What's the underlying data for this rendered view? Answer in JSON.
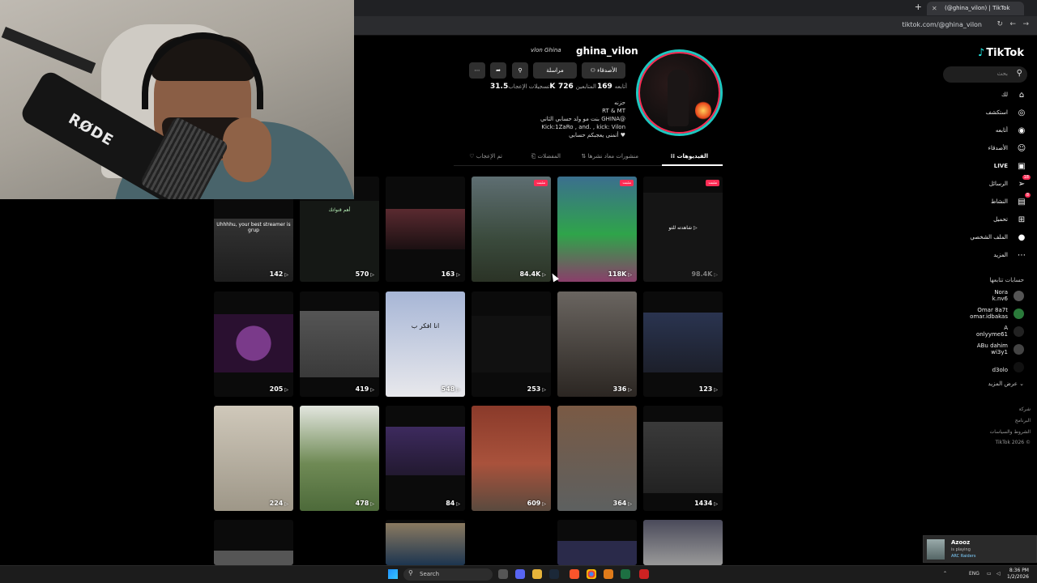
{
  "browser": {
    "tab_title": "(@ghina_vilon) | TikTok",
    "url": "tiktok.com/@ghina_vilon"
  },
  "sidebar": {
    "logo": "TikTok",
    "search_placeholder": "بحث",
    "items": [
      {
        "label": "لك",
        "icon": "home-icon"
      },
      {
        "label": "استكشف",
        "icon": "compass-icon"
      },
      {
        "label": "أتابعه",
        "icon": "following-icon"
      },
      {
        "label": "الأصدقاء",
        "icon": "friends-icon"
      },
      {
        "label": "LIVE",
        "icon": "live-icon"
      },
      {
        "label": "الرسائل",
        "icon": "messages-icon",
        "badge": "18"
      },
      {
        "label": "النشاط",
        "icon": "activity-icon",
        "badge": "8"
      },
      {
        "label": "تحميل",
        "icon": "upload-icon"
      },
      {
        "label": "الملف الشخصي",
        "icon": "profile-icon"
      },
      {
        "label": "المزيد",
        "icon": "more-icon"
      }
    ],
    "following_title": "حسابات تتابعها",
    "following": [
      {
        "name": "Nora",
        "handle": "k.nv6"
      },
      {
        "name": "Omar 8a7t",
        "handle": "omar.idbakas"
      },
      {
        "name": "A",
        "handle": "onlyyme61"
      },
      {
        "name": "ABu dahim",
        "handle": "wi3y1"
      },
      {
        "name": "",
        "handle": "d3olo"
      }
    ],
    "show_more": "عرض المزيد",
    "footer": [
      "شركة",
      "البرنامج",
      "الشروط والسياسات",
      "TikTok 2026 ©"
    ]
  },
  "profile": {
    "username": "ghina_vilon",
    "nickname": "vlon Ghina",
    "follow_button": "الأصدقاء",
    "message_button": "مراسلة",
    "following_count": "169",
    "following_label": "أتابعه",
    "followers_count": "726",
    "followers_label": "المتابعين",
    "likes_count": "31.5K",
    "likes_label": "تسجيلات الإعجاب",
    "bio_lines": [
      "حزنه",
      "RT & MT",
      "بنت مو ولد حسابي الثاني GHINA@",
      "Kick:1ZaRo , and. , kick: Vilon",
      "أتمنى يعجبكم حسابي ♥"
    ],
    "tabs": [
      "الفيديوهات",
      "منشورات معاد نشرها",
      "المفضلات",
      "تم الإعجاب"
    ]
  },
  "videos": [
    {
      "views": "142",
      "caption": "Uhhhhu, your best streamer is grup"
    },
    {
      "views": "570",
      "caption": "أهم قنواتك"
    },
    {
      "views": "163",
      "caption": ""
    },
    {
      "views": "84.4K",
      "caption": "",
      "pinned": "مثبت"
    },
    {
      "views": "118K",
      "caption": "",
      "pinned": "مثبت"
    },
    {
      "views": "98.4K",
      "caption": "شاهدته للتو",
      "pinned": "مثبت"
    },
    {
      "views": "205",
      "caption": ""
    },
    {
      "views": "419",
      "caption": ""
    },
    {
      "views": "548",
      "caption": "انا افكر ب"
    },
    {
      "views": "253",
      "caption": ""
    },
    {
      "views": "336",
      "caption": ""
    },
    {
      "views": "123",
      "caption": ""
    },
    {
      "views": "224",
      "caption": ""
    },
    {
      "views": "478",
      "caption": ""
    },
    {
      "views": "84",
      "caption": ""
    },
    {
      "views": "609",
      "caption": ""
    },
    {
      "views": "364",
      "caption": ""
    },
    {
      "views": "1434",
      "caption": ""
    }
  ],
  "taskbar": {
    "search": "Search",
    "lang": "ENG",
    "time": "8:36 PM",
    "date": "1/2/2026"
  },
  "notification": {
    "name": "Azooz",
    "status": "is playing",
    "game": "ARC Raiders"
  },
  "webcam": {
    "mic_brand": "RØDE"
  }
}
